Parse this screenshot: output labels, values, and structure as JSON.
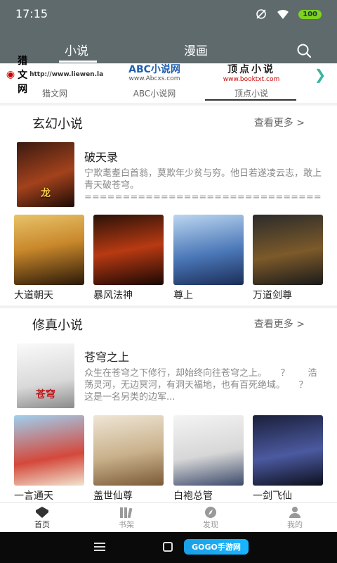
{
  "status": {
    "time": "17:15",
    "battery": "100"
  },
  "top_tabs": [
    {
      "label": "小说"
    },
    {
      "label": "漫画"
    }
  ],
  "sources": [
    {
      "logo": "猎文网",
      "logo_sub": "http://www.liewen.la",
      "label": "猎文网"
    },
    {
      "logo": "ABC小说网",
      "logo_sub": "www.Abcxs.com",
      "label": "ABC小说网"
    },
    {
      "logo": "顶点小说",
      "logo_sub": "www.booktxt.com",
      "label": "顶点小说"
    }
  ],
  "sections": [
    {
      "title": "玄幻小说",
      "more": "查看更多 >",
      "featured": {
        "title": "破天录",
        "desc": "宁欺耄耋白首翁，莫欺年少贫与穷。他日若遂凌云志，敢上青天破苍穹。=================================================== 2..."
      },
      "grid": [
        {
          "title": "大道朝天"
        },
        {
          "title": "暴风法神"
        },
        {
          "title": "尊上"
        },
        {
          "title": "万道剑尊"
        }
      ]
    },
    {
      "title": "修真小说",
      "more": "查看更多 >",
      "featured": {
        "title": "苍穹之上",
        "desc": "众生在苍穹之下修行，却始终向往苍穹之上。　　？　　浩荡灵河，无边冥河，有洞天福地，也有百死绝域。　　？　　这是一名另类的边军..."
      },
      "grid": [
        {
          "title": "一言通天"
        },
        {
          "title": "盖世仙尊"
        },
        {
          "title": "白袍总管"
        },
        {
          "title": "一剑飞仙"
        }
      ]
    }
  ],
  "bottom_nav": [
    {
      "label": "首页"
    },
    {
      "label": "书架"
    },
    {
      "label": "发现"
    },
    {
      "label": "我的"
    }
  ],
  "watermark": "GOGO手游网",
  "colors": {
    "top_bar": "#5f6a6d",
    "active_text": "#333333",
    "muted_text": "#888888"
  }
}
